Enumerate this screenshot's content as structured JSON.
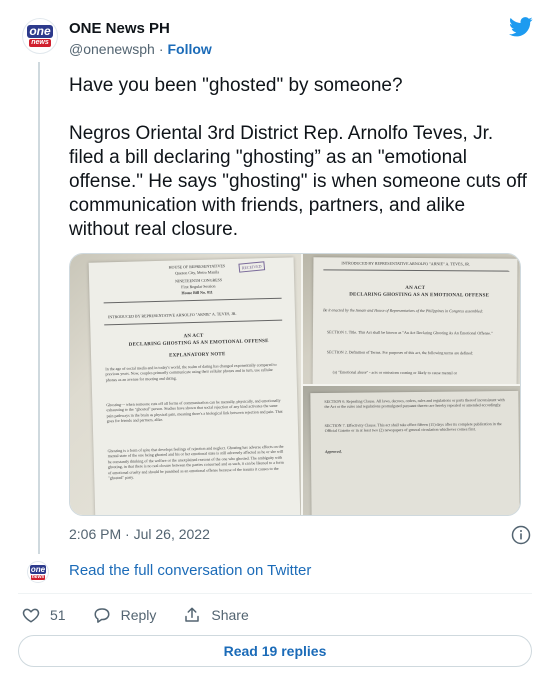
{
  "author": {
    "name": "ONE News PH",
    "handle": "@onenewsph",
    "separator": "·",
    "follow_label": "Follow",
    "avatar_logo_top": "one",
    "avatar_logo_bottom": "news"
  },
  "tweet": {
    "text": "Have you been \"ghosted\" by someone?\n\nNegros Oriental 3rd District Rep. Arnolfo Teves, Jr. filed a bill declaring \"ghosting” as an \"emotional offense.\" He says \"ghosting\" is when someone cuts off communication with friends, partners, and alike without real closure.",
    "timestamp": "2:06 PM · Jul 26, 2022"
  },
  "media": {
    "doc1": {
      "header_lines": [
        "HOUSE OF REPRESENTATIVES",
        "Quezon City, Metro Manila",
        "NINETEENTH CONGRESS",
        "First Regular Session",
        "House Bill No. 811"
      ],
      "stamp": "RECEIVED",
      "introduced_by": "INTRODUCED BY REPRESENTATIVE ARNOLFO \"ARNIE\" A. TEVES, JR.",
      "act_title_1": "AN ACT",
      "act_title_2": "DECLARING GHOSTING AS AN EMOTIONAL OFFENSE",
      "explanatory_note": "EXPLANATORY NOTE",
      "para1": "In the age of social media and in today's world, the realm of dating has changed exponentially compared to previous years. Now, couples primarily communicate using their cellular phones and in turn, use cellular phones as an avenue for meeting and dating.",
      "para2": "Ghosting— when someone cuts off all forms of communication can be mentally, physically, and emotionally exhausting to the \"ghosted\" person. Studies have shown that social rejection of any kind activates the same pain pathways in the brain as physical pain, meaning there's a biological link between rejection and pain. That goes for friends and partners, alike.",
      "para3": "Ghosting is a form of spite that develops feelings of rejection and neglect. Ghosting has adverse effects on the mental state of the one being ghosted and his or her emotional state is still adversely affected as he or she will be constantly thinking of the welfare or the unexplained reasons of the one who ghosted. The ambiguity with ghosting, in that there is no real closure between the parties concerned and as such, it can be likened to a form of emotional cruelty and should be punished as an emotional offense because of the trauma it causes to the \"ghosted\" party."
    },
    "doc2": {
      "introduced_by": "INTRODUCED BY REPRESENTATIVE ARNOLFO \"ARNIE\" A. TEVES, JR.",
      "act_title_1": "AN ACT",
      "act_title_2": "DECLARING GHOSTING AS AN EMOTIONAL OFFENSE",
      "enacting": "Be it enacted by the Senate and House of Representatives of the Philippines in Congress assembled:",
      "section1": "SECTION 1. Title. This Act shall be known as \"An Act Declaring Ghosting As An Emotional Offense.\"",
      "section2": "SECTION 2. Definition of Terms. For purposes of this act, the following terms are defined:",
      "section2a": "(a) \"Emotional abuse\" - acts or omissions causing or likely to cause mental or"
    },
    "doc3": {
      "section6": "SECTION 6. Repealing Clause. All laws, decrees, orders, rules and regulations or parts thereof inconsistent with the Act or the rules and regulations promulgated pursuant thereto are hereby repealed or amended accordingly.",
      "section7": "SECTION 7. Effectivity Clause. This act shall take effect fifteen (15) days after its complete publication in the Official Gazette or in at least two (2) newspapers of general circulation whichever comes first.",
      "approved": "Approved,"
    }
  },
  "footer": {
    "read_conversation": "Read the full conversation on Twitter",
    "like_count": "51",
    "reply_label": "Reply",
    "share_label": "Share",
    "read_replies": "Read 19 replies"
  },
  "icons": {
    "brand": "twitter-bird-icon",
    "info": "info-icon",
    "like": "heart-icon",
    "reply": "speech-bubble-icon",
    "share": "share-arrow-icon"
  },
  "colors": {
    "twitter_blue": "#1d9bf0",
    "link_blue": "#1b6bb8",
    "text_primary": "#0f1419",
    "text_secondary": "#536471",
    "border": "#cfd9de",
    "brand_navy": "#2d3a8c",
    "brand_red": "#d0202e"
  }
}
